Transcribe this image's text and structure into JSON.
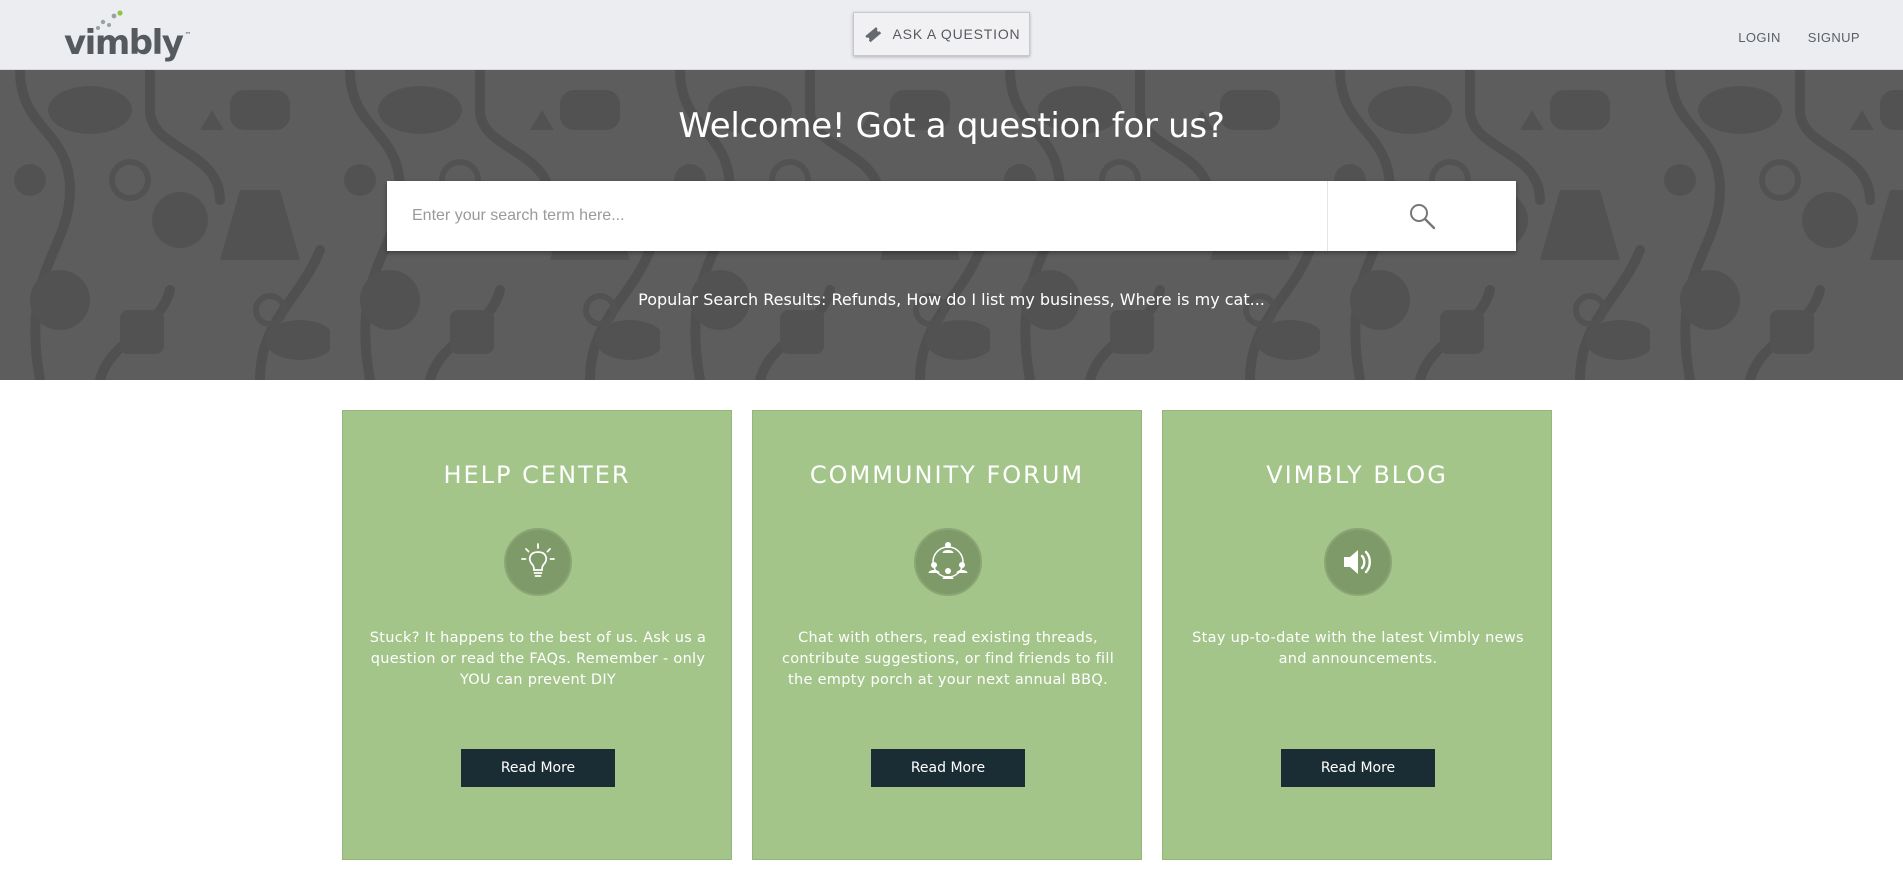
{
  "header": {
    "logo_text": "vimbly",
    "logo_tm": "™",
    "ask_button_label": "ASK A QUESTION",
    "nav": {
      "login": "LOGIN",
      "signup": "SIGNUP"
    }
  },
  "hero": {
    "title": "Welcome! Got a question for us?",
    "search": {
      "placeholder": "Enter your search term here...",
      "value": ""
    },
    "popular_text": "Popular Search Results: Refunds, How do I list my business, Where is my cat..."
  },
  "cards": [
    {
      "title": "HELP CENTER",
      "icon": "lightbulb-icon",
      "description": "Stuck? It happens to the best of us. Ask us a question or read the FAQs. Remember - only YOU can prevent DIY",
      "button_label": "Read More"
    },
    {
      "title": "COMMUNITY FORUM",
      "icon": "community-network-icon",
      "description": "Chat with others, read existing threads, contribute suggestions, or find friends to fill the empty porch at your next annual BBQ.",
      "button_label": "Read More"
    },
    {
      "title": "VIMBLY BLOG",
      "icon": "speaker-icon",
      "description": "Stay up-to-date with the latest Vimbly news and announcements.",
      "button_label": "Read More"
    }
  ],
  "colors": {
    "header_bg": "#ecedf1",
    "hero_bg": "#5d5d5d",
    "card_bg": "#a3c58a",
    "button_bg": "#1a2d35",
    "logo_accent": "#8dc63f"
  }
}
